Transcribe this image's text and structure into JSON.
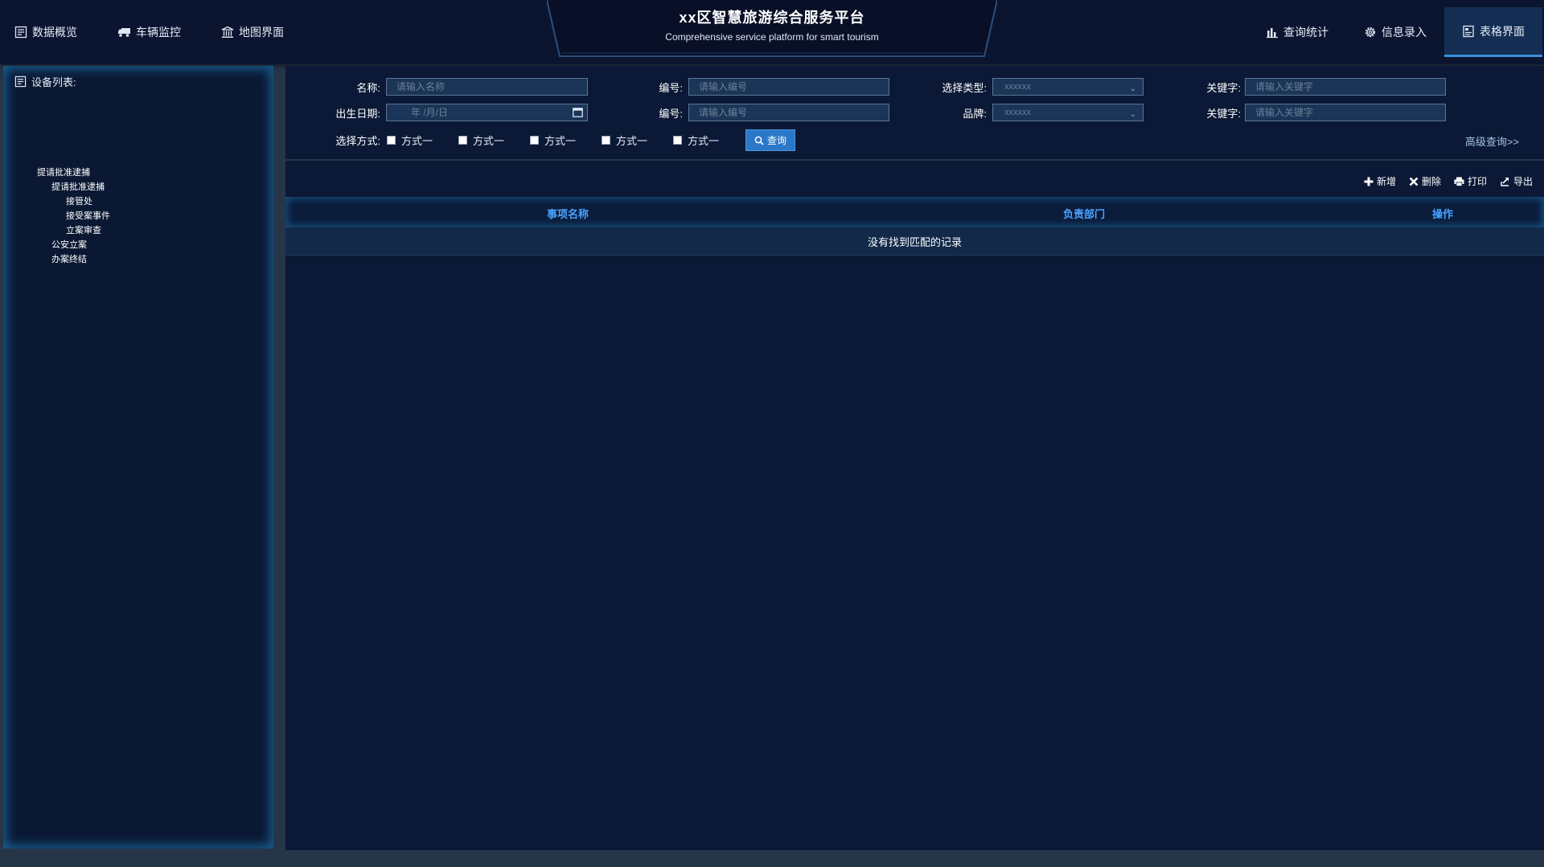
{
  "header": {
    "title": "xx区智慧旅游综合服务平台",
    "subtitle": "Comprehensive service platform for smart tourism",
    "nav_left": [
      {
        "label": "数据概览",
        "icon": "list-icon"
      },
      {
        "label": "车辆监控",
        "icon": "truck-icon"
      },
      {
        "label": "地图界面",
        "icon": "bank-icon"
      }
    ],
    "nav_right": [
      {
        "label": "查询统计",
        "icon": "bar-chart-icon"
      },
      {
        "label": "信息录入",
        "icon": "gear-icon"
      },
      {
        "label": "表格界面",
        "icon": "table-doc-icon",
        "active": true
      }
    ]
  },
  "sidebar": {
    "title": "设备列表:",
    "tree": [
      {
        "label": "提请批准逮捕",
        "level": 0
      },
      {
        "label": "提请批准逮捕",
        "level": 1
      },
      {
        "label": "接管处",
        "level": 2
      },
      {
        "label": "接受案事件",
        "level": 2
      },
      {
        "label": "立案审查",
        "level": 2
      },
      {
        "label": "公安立案",
        "level": 1
      },
      {
        "label": "办案终结",
        "level": 1
      }
    ]
  },
  "search": {
    "name_label": "名称:",
    "name_placeholder": "请输入名称",
    "code_label_1": "编号:",
    "code_placeholder_1": "请输入编号",
    "type_label": "选择类型:",
    "type_value": "xxxxxx",
    "keyword_label_1": "关键字:",
    "keyword_placeholder_1": "请输入关键字",
    "birth_label": "出生日期:",
    "birth_placeholder": "年 /月/日",
    "code_label_2": "编号:",
    "code_placeholder_2": "请输入编号",
    "brand_label": "品牌:",
    "brand_value": "xxxxxx",
    "keyword_label_2": "关键字:",
    "keyword_placeholder_2": "请输入关键字",
    "mode_label": "选择方式:",
    "modes": [
      "方式一",
      "方式一",
      "方式一",
      "方式一",
      "方式一"
    ],
    "query_button": "查询",
    "advanced_link": "高级查询>>"
  },
  "toolbar": {
    "add": "新增",
    "delete": "删除",
    "print": "打印",
    "export": "导出"
  },
  "table": {
    "columns": [
      "事项名称",
      "负责部门",
      "操作"
    ],
    "empty_message": "没有找到匹配的记录"
  },
  "colors": {
    "background": "#0b1936",
    "header": "#0b1530",
    "accent": "#2b78c8",
    "column_header_text": "#4aa3ff",
    "glow": "#2896dc"
  }
}
